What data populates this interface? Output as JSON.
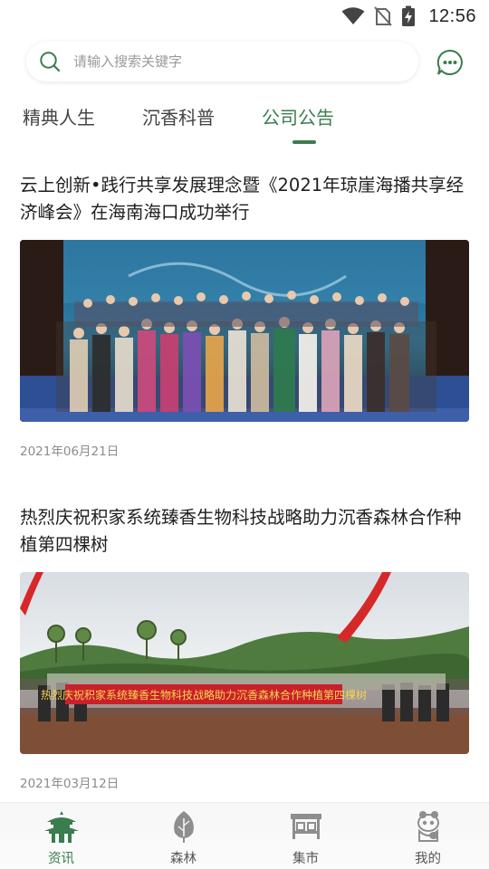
{
  "status_bar": {
    "time": "12:56",
    "icons": [
      "wifi-icon",
      "no-sim-icon",
      "battery-charging-icon"
    ]
  },
  "search": {
    "placeholder": "请输入搜索关键字",
    "value": ""
  },
  "header_actions": {
    "chat_icon": "chat-bubble-icon"
  },
  "tabs": [
    {
      "label": "精典人生",
      "active": false
    },
    {
      "label": "沉香科普",
      "active": false
    },
    {
      "label": "公司公告",
      "active": true
    }
  ],
  "news": [
    {
      "title": "云上创新•践行共享发展理念暨《2021年琼崖海播共享经济峰会》在海南海口成功举行",
      "date": "2021年06月21日"
    },
    {
      "title": "热烈庆祝积家系统臻香生物科技战略助力沉香森林合作种植第四棵树",
      "date": "2021年03月12日",
      "banner_text": "热烈庆祝积家系统臻香生物科技战略助力沉香森林合作种植第四棵树"
    }
  ],
  "bottom_nav": [
    {
      "label": "资讯",
      "icon": "pagoda-icon",
      "active": true
    },
    {
      "label": "森林",
      "icon": "tree-leaf-icon",
      "active": false
    },
    {
      "label": "集市",
      "icon": "market-stall-icon",
      "active": false
    },
    {
      "label": "我的",
      "icon": "panda-icon",
      "active": false
    }
  ],
  "colors": {
    "accent": "#3a7d4f",
    "text": "#1f1f1f",
    "muted": "#8c8c8c"
  }
}
